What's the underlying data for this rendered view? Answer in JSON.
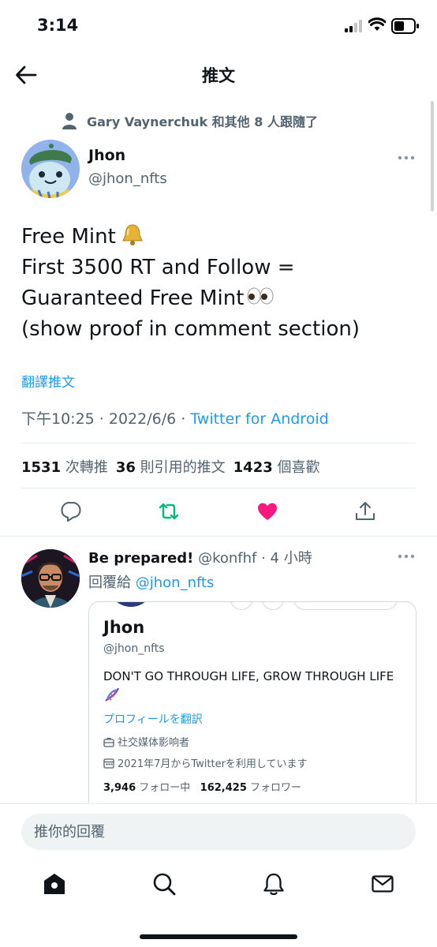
{
  "status_bar": {
    "time": "3:14"
  },
  "header": {
    "title": "推文"
  },
  "social_context": {
    "text": "Gary Vaynerchuk 和其他 8 人跟隨了"
  },
  "tweet": {
    "author_name": "Jhon",
    "author_handle": "@jhon_nfts",
    "lines": [
      "Free Mint",
      "First 3500 RT and Follow  =",
      "Guaranteed Free Mint",
      "(show proof in comment section)"
    ],
    "translate_label": "翻譯推文",
    "timestamp": "下午10:25 · 2022/6/6 · ",
    "source": "Twitter for Android",
    "stats": {
      "retweets": "1531",
      "retweets_label": "次轉推",
      "quotes": "36",
      "quotes_label": "則引用的推文",
      "likes": "1423",
      "likes_label": "個喜歡"
    },
    "liked": true,
    "colors": {
      "reply": "#536471",
      "retweet": "#00ba7c",
      "like": "#f91880",
      "share": "#536471"
    }
  },
  "reply": {
    "name": "Be prepared!",
    "handle_time": " @konfhf · 4 小時",
    "replying_to_label": "回覆給 ",
    "replying_to_handle": "@jhon_nfts",
    "card": {
      "name": "Jhon",
      "handle": "@jhon_nfts",
      "bio": "DON'T GO THROUGH LIFE, GROW THROUGH LIFE",
      "translate_label": "プロフィールを翻訳",
      "category": "社交媒体影响者",
      "joined": "2021年7月からTwitterを利用しています",
      "following_count": "3,946",
      "following_label": " フォロー中",
      "followers_count": "162,425",
      "followers_label": " フォロワー"
    }
  },
  "composer": {
    "placeholder": "推你的回覆"
  },
  "icons": {
    "back": "arrow-left-icon",
    "more": "more-horizontal-icon",
    "person": "person-icon",
    "reply": "reply-bubble-icon",
    "retweet": "retweet-icon",
    "like": "heart-icon",
    "share": "share-icon",
    "home": "home-icon",
    "search": "search-icon",
    "notifications": "bell-icon",
    "messages": "mail-icon"
  }
}
